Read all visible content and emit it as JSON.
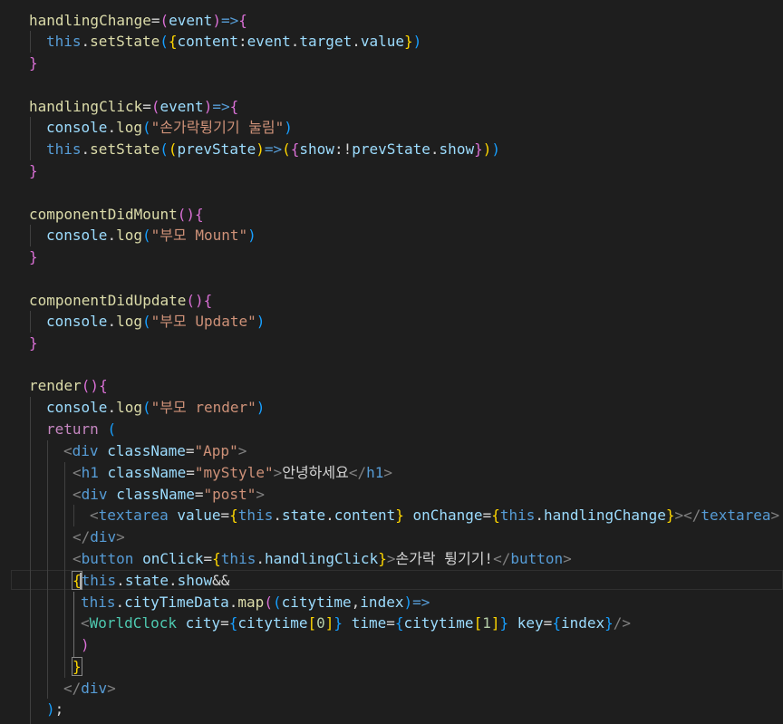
{
  "editor": {
    "language": "javascript-react",
    "theme_colors": {
      "background": "#1e1e1e",
      "function": "#dcdcaa",
      "variable": "#9cdcfe",
      "keyword": "#569cd6",
      "control": "#c586c0",
      "string": "#ce9178",
      "component": "#4ec9b0",
      "bracket_1": "#ffd700",
      "bracket_2": "#da70d6",
      "bracket_3": "#179fff"
    },
    "lines": [
      {
        "tokens": [
          [
            "fn",
            "handlingChange"
          ],
          [
            "op",
            "="
          ],
          [
            "b2",
            "("
          ],
          [
            "var",
            "event"
          ],
          [
            "b2",
            ")"
          ],
          [
            "kw",
            "=>"
          ],
          [
            "b2",
            "{"
          ]
        ]
      },
      {
        "tokens": [
          [
            "kw",
            "this"
          ],
          [
            "op",
            "."
          ],
          [
            "fn",
            "setState"
          ],
          [
            "b3",
            "("
          ],
          [
            "b1",
            "{"
          ],
          [
            "var",
            "content"
          ],
          [
            "op",
            ":"
          ],
          [
            "var",
            "event"
          ],
          [
            "op",
            "."
          ],
          [
            "var",
            "target"
          ],
          [
            "op",
            "."
          ],
          [
            "var",
            "value"
          ],
          [
            "b1",
            "}"
          ],
          [
            "b3",
            ")"
          ]
        ]
      },
      {
        "tokens": [
          [
            "b2",
            "}"
          ]
        ]
      },
      {
        "tokens": []
      },
      {
        "tokens": [
          [
            "fn",
            "handlingClick"
          ],
          [
            "op",
            "="
          ],
          [
            "b2",
            "("
          ],
          [
            "var",
            "event"
          ],
          [
            "b2",
            ")"
          ],
          [
            "kw",
            "=>"
          ],
          [
            "b2",
            "{"
          ]
        ]
      },
      {
        "tokens": [
          [
            "var",
            "console"
          ],
          [
            "op",
            "."
          ],
          [
            "fn",
            "log"
          ],
          [
            "b3",
            "("
          ],
          [
            "str",
            "\"손가락튕기기 눌림\""
          ],
          [
            "b3",
            ")"
          ]
        ]
      },
      {
        "tokens": [
          [
            "kw",
            "this"
          ],
          [
            "op",
            "."
          ],
          [
            "fn",
            "setState"
          ],
          [
            "b3",
            "("
          ],
          [
            "b1",
            "("
          ],
          [
            "var",
            "prevState"
          ],
          [
            "b1",
            ")"
          ],
          [
            "kw",
            "=>"
          ],
          [
            "b1",
            "("
          ],
          [
            "b2",
            "{"
          ],
          [
            "var",
            "show"
          ],
          [
            "op",
            ":!"
          ],
          [
            "var",
            "prevState"
          ],
          [
            "op",
            "."
          ],
          [
            "var",
            "show"
          ],
          [
            "b2",
            "}"
          ],
          [
            "b1",
            ")"
          ],
          [
            "b3",
            ")"
          ]
        ]
      },
      {
        "tokens": [
          [
            "b2",
            "}"
          ]
        ]
      },
      {
        "tokens": []
      },
      {
        "tokens": [
          [
            "fn",
            "componentDidMount"
          ],
          [
            "b2",
            "()"
          ],
          [
            "b2",
            "{"
          ]
        ]
      },
      {
        "tokens": [
          [
            "var",
            "console"
          ],
          [
            "op",
            "."
          ],
          [
            "fn",
            "log"
          ],
          [
            "b3",
            "("
          ],
          [
            "str",
            "\"부모 Mount\""
          ],
          [
            "b3",
            ")"
          ]
        ]
      },
      {
        "tokens": [
          [
            "b2",
            "}"
          ]
        ]
      },
      {
        "tokens": []
      },
      {
        "tokens": [
          [
            "fn",
            "componentDidUpdate"
          ],
          [
            "b2",
            "()"
          ],
          [
            "b2",
            "{"
          ]
        ]
      },
      {
        "tokens": [
          [
            "var",
            "console"
          ],
          [
            "op",
            "."
          ],
          [
            "fn",
            "log"
          ],
          [
            "b3",
            "("
          ],
          [
            "str",
            "\"부모 Update\""
          ],
          [
            "b3",
            ")"
          ]
        ]
      },
      {
        "tokens": [
          [
            "b2",
            "}"
          ]
        ]
      },
      {
        "tokens": []
      },
      {
        "tokens": [
          [
            "fn",
            "render"
          ],
          [
            "b2",
            "()"
          ],
          [
            "b2",
            "{"
          ]
        ]
      },
      {
        "tokens": [
          [
            "var",
            "console"
          ],
          [
            "op",
            "."
          ],
          [
            "fn",
            "log"
          ],
          [
            "b3",
            "("
          ],
          [
            "str",
            "\"부모 render\""
          ],
          [
            "b3",
            ")"
          ]
        ]
      },
      {
        "tokens": [
          [
            "ctl",
            "return"
          ],
          [
            "op",
            " "
          ],
          [
            "b3",
            "("
          ]
        ]
      },
      {
        "tokens": [
          [
            "gray",
            "<"
          ],
          [
            "tag",
            "div"
          ],
          [
            "op",
            " "
          ],
          [
            "attr",
            "className"
          ],
          [
            "op",
            "="
          ],
          [
            "str",
            "\"App\""
          ],
          [
            "gray",
            ">"
          ]
        ]
      },
      {
        "tokens": [
          [
            "gray",
            "<"
          ],
          [
            "tag",
            "h1"
          ],
          [
            "op",
            " "
          ],
          [
            "attr",
            "className"
          ],
          [
            "op",
            "="
          ],
          [
            "str",
            "\"myStyle\""
          ],
          [
            "gray",
            ">"
          ],
          [
            "txt",
            "안녕하세요"
          ],
          [
            "gray",
            "</"
          ],
          [
            "tag",
            "h1"
          ],
          [
            "gray",
            ">"
          ]
        ]
      },
      {
        "tokens": [
          [
            "gray",
            "<"
          ],
          [
            "tag",
            "div"
          ],
          [
            "op",
            " "
          ],
          [
            "attr",
            "className"
          ],
          [
            "op",
            "="
          ],
          [
            "str",
            "\"post\""
          ],
          [
            "gray",
            ">"
          ]
        ]
      },
      {
        "tokens": [
          [
            "gray",
            "<"
          ],
          [
            "tag",
            "textarea"
          ],
          [
            "op",
            " "
          ],
          [
            "attr",
            "value"
          ],
          [
            "op",
            "="
          ],
          [
            "b1",
            "{"
          ],
          [
            "kw",
            "this"
          ],
          [
            "op",
            "."
          ],
          [
            "var",
            "state"
          ],
          [
            "op",
            "."
          ],
          [
            "var",
            "content"
          ],
          [
            "b1",
            "}"
          ],
          [
            "op",
            " "
          ],
          [
            "attr",
            "onChange"
          ],
          [
            "op",
            "="
          ],
          [
            "b1",
            "{"
          ],
          [
            "kw",
            "this"
          ],
          [
            "op",
            "."
          ],
          [
            "var",
            "handlingChange"
          ],
          [
            "b1",
            "}"
          ],
          [
            "gray",
            "></"
          ],
          [
            "tag",
            "textarea"
          ],
          [
            "gray",
            ">"
          ]
        ]
      },
      {
        "tokens": [
          [
            "gray",
            "</"
          ],
          [
            "tag",
            "div"
          ],
          [
            "gray",
            ">"
          ]
        ]
      },
      {
        "tokens": [
          [
            "gray",
            "<"
          ],
          [
            "tag",
            "button"
          ],
          [
            "op",
            " "
          ],
          [
            "attr",
            "onClick"
          ],
          [
            "op",
            "="
          ],
          [
            "b1",
            "{"
          ],
          [
            "kw",
            "this"
          ],
          [
            "op",
            "."
          ],
          [
            "var",
            "handlingClick"
          ],
          [
            "b1",
            "}"
          ],
          [
            "gray",
            ">"
          ],
          [
            "txt",
            "손가락 튕기기!"
          ],
          [
            "gray",
            "</"
          ],
          [
            "tag",
            "button"
          ],
          [
            "gray",
            ">"
          ]
        ]
      },
      {
        "tokens": [
          [
            "b1box",
            "{"
          ],
          [
            "kw",
            "this"
          ],
          [
            "op",
            "."
          ],
          [
            "var",
            "state"
          ],
          [
            "op",
            "."
          ],
          [
            "var",
            "show"
          ],
          [
            "op",
            "&&"
          ]
        ]
      },
      {
        "tokens": [
          [
            "kw",
            "this"
          ],
          [
            "op",
            "."
          ],
          [
            "var",
            "cityTimeData"
          ],
          [
            "op",
            "."
          ],
          [
            "fn",
            "map"
          ],
          [
            "b2",
            "("
          ],
          [
            "b3",
            "("
          ],
          [
            "var",
            "citytime"
          ],
          [
            "op",
            ","
          ],
          [
            "var",
            "index"
          ],
          [
            "b3",
            ")"
          ],
          [
            "kw",
            "=>"
          ]
        ]
      },
      {
        "tokens": [
          [
            "gray",
            "<"
          ],
          [
            "comp",
            "WorldClock"
          ],
          [
            "op",
            " "
          ],
          [
            "attr",
            "city"
          ],
          [
            "op",
            "="
          ],
          [
            "b3",
            "{"
          ],
          [
            "var",
            "citytime"
          ],
          [
            "b1",
            "["
          ],
          [
            "num",
            "0"
          ],
          [
            "b1",
            "]"
          ],
          [
            "b3",
            "}"
          ],
          [
            "op",
            " "
          ],
          [
            "attr",
            "time"
          ],
          [
            "op",
            "="
          ],
          [
            "b3",
            "{"
          ],
          [
            "var",
            "citytime"
          ],
          [
            "b1",
            "["
          ],
          [
            "num",
            "1"
          ],
          [
            "b1",
            "]"
          ],
          [
            "b3",
            "}"
          ],
          [
            "op",
            " "
          ],
          [
            "attr",
            "key"
          ],
          [
            "op",
            "="
          ],
          [
            "b3",
            "{"
          ],
          [
            "var",
            "index"
          ],
          [
            "b3",
            "}"
          ],
          [
            "gray",
            "/>"
          ]
        ]
      },
      {
        "tokens": [
          [
            "b2",
            ")"
          ]
        ]
      },
      {
        "tokens": [
          [
            "b1box",
            "}"
          ]
        ]
      },
      {
        "tokens": [
          [
            "gray",
            "</"
          ],
          [
            "tag",
            "div"
          ],
          [
            "gray",
            ">"
          ]
        ]
      },
      {
        "tokens": [
          [
            "b3",
            ")"
          ],
          [
            "op",
            ";"
          ]
        ]
      }
    ]
  }
}
